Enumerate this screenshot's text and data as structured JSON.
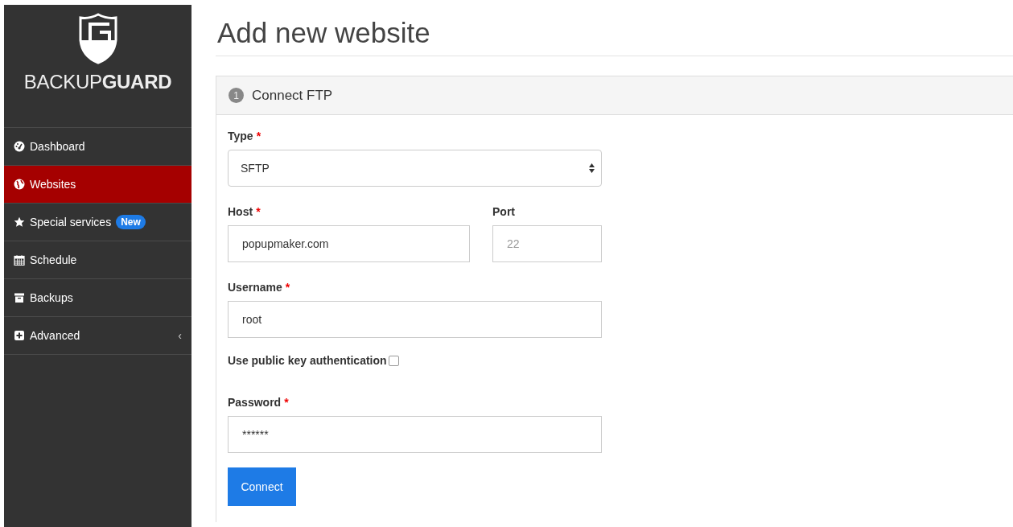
{
  "sidebar": {
    "logo_text": "BACKUP**GUARD**",
    "items": [
      {
        "label": "Dashboard",
        "selected": false
      },
      {
        "label": "Websites",
        "selected": true
      },
      {
        "label": "Special services",
        "selected": false,
        "badge": "New"
      },
      {
        "label": "Schedule",
        "selected": false
      },
      {
        "label": "Backups",
        "selected": false
      },
      {
        "label": "Advanced",
        "selected": false,
        "expander": "‹"
      }
    ]
  },
  "page": {
    "title": "Add new website"
  },
  "panel": {
    "step": "1",
    "title": "Connect FTP",
    "fields": [
      {
        "kind": "select",
        "label": "Type",
        "required": "*",
        "value": "SFTP"
      },
      {
        "kind": "pair",
        "items": [
          {
            "label": "Host",
            "required": "*",
            "value": "popupmaker.com"
          },
          {
            "label": "Port",
            "placeholder": "22"
          }
        ]
      },
      {
        "kind": "text",
        "label": "Username",
        "required": "*",
        "value": "root"
      },
      {
        "kind": "checkbox",
        "label": "Use public key authentication",
        "checked": false
      },
      {
        "kind": "password",
        "label": "Password",
        "required": "*",
        "value": "******"
      }
    ],
    "button": "Connect"
  }
}
